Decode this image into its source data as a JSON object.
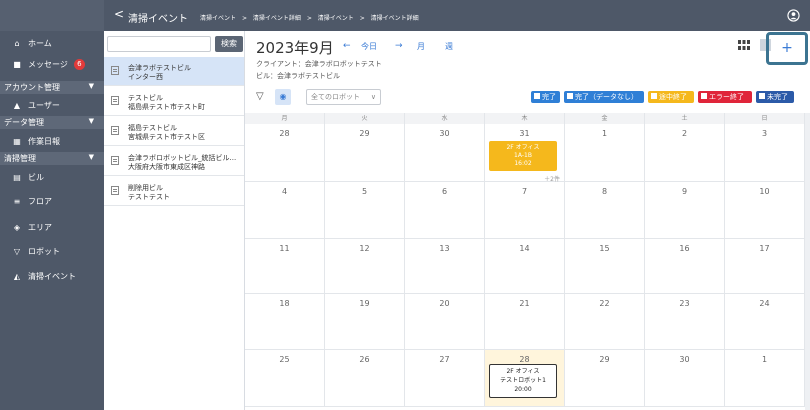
{
  "header": {
    "back_glyph": "<",
    "title": "清掃イベント",
    "breadcrumbs": [
      "清掃イベント",
      ">",
      "清掃イベント詳細",
      ">",
      "清掃イベント",
      ">",
      "清掃イベント詳細"
    ],
    "user_icon": "user-circle-icon"
  },
  "sidebar": {
    "items": [
      {
        "icon": "home-icon",
        "glyph": "⌂",
        "label": "ホーム"
      },
      {
        "icon": "message-icon",
        "glyph": "■",
        "label": "メッセージ",
        "badge": "6"
      },
      {
        "section": "アカウント管理"
      },
      {
        "icon": "user-icon",
        "glyph": "▲",
        "label": "ユーザー"
      },
      {
        "section": "データ管理"
      },
      {
        "icon": "work-log-icon",
        "glyph": "▦",
        "label": "作業日報"
      },
      {
        "section": "清掃管理"
      },
      {
        "icon": "building-icon",
        "glyph": "▤",
        "label": "ビル"
      },
      {
        "icon": "floor-icon",
        "glyph": "≡",
        "label": "フロア"
      },
      {
        "icon": "area-icon",
        "glyph": "◈",
        "label": "エリア"
      },
      {
        "icon": "robot-icon",
        "glyph": "▽",
        "label": "ロボット"
      },
      {
        "icon": "cleaning-event-icon",
        "glyph": "◭",
        "label": "清掃イベント"
      }
    ]
  },
  "building_list": {
    "search_placeholder": "",
    "search_button": "検索",
    "items": [
      {
        "line1": "会津ラボテストビル",
        "line2": "インター西",
        "selected": true
      },
      {
        "line1": "テストビル",
        "line2": "福島県テスト市テスト町",
        "selected": false
      },
      {
        "line1": "福島テストビル",
        "line2": "宮城県テスト市テスト区",
        "selected": false
      },
      {
        "line1": "会津ラボロボットビル_統括ビル...",
        "line2": "大阪府大阪市東成区神路",
        "selected": false
      },
      {
        "line1": "削除用ビル",
        "line2": "テストテスト",
        "selected": false
      }
    ]
  },
  "calendar": {
    "month_title": "2023年9月",
    "prev": "←",
    "today": "今日",
    "next": "→",
    "view_month": "月",
    "view_week": "週",
    "client": "クライアント：会津ラボロボットテスト",
    "building": "ビル：会津ラボテストビル",
    "robot_select": "全てのロボット",
    "add_button": "+",
    "legend": [
      {
        "label": "完了",
        "color": "#2f7fd6"
      },
      {
        "label": "完了（データなし）",
        "color": "#2f7fd6"
      },
      {
        "label": "途中終了",
        "color": "#f5b81c"
      },
      {
        "label": "エラー終了",
        "color": "#e0253a"
      },
      {
        "label": "未完了",
        "color": "#2b5aa8"
      }
    ],
    "weekdays": [
      "月",
      "火",
      "水",
      "木",
      "金",
      "土",
      "日"
    ],
    "weeks": [
      [
        "28",
        "29",
        "30",
        "31",
        "1",
        "2",
        "3"
      ],
      [
        "4",
        "5",
        "6",
        "7",
        "8",
        "9",
        "10"
      ],
      [
        "11",
        "12",
        "13",
        "14",
        "15",
        "16",
        "17"
      ],
      [
        "18",
        "19",
        "20",
        "21",
        "22",
        "23",
        "24"
      ],
      [
        "25",
        "26",
        "27",
        "28",
        "29",
        "30",
        "1"
      ]
    ],
    "event_31": {
      "l1": "2F オフィス",
      "l2": "1A-1B",
      "l3": "16:02",
      "more": "＋2件"
    },
    "event_28": {
      "l1": "2F オフィス",
      "l2": "テストロボット1",
      "l3": "20:00"
    }
  }
}
